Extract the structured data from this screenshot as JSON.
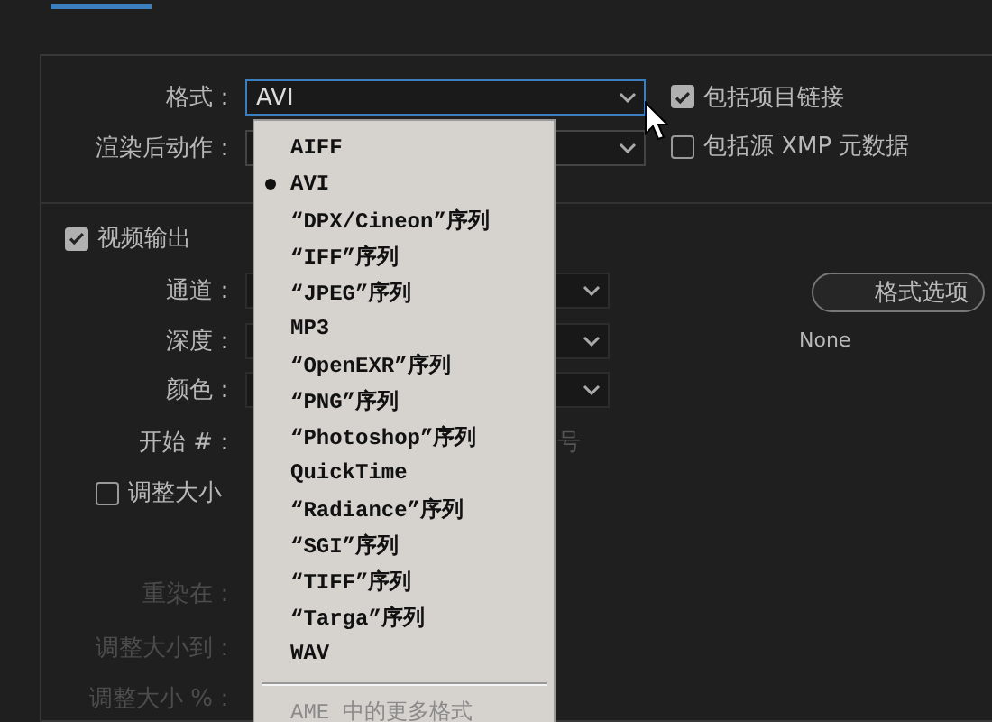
{
  "format": {
    "label": "格式：",
    "value": "AVI"
  },
  "post_render": {
    "label": "渲染后动作："
  },
  "options": [
    {
      "label": "包括项目链接",
      "checked": true
    },
    {
      "label": "包括源 XMP 元数据",
      "checked": false
    }
  ],
  "video_output": {
    "label": "视频输出",
    "checked": true
  },
  "video_fields": [
    {
      "label": "通道："
    },
    {
      "label": "深度："
    },
    {
      "label": "颜色："
    },
    {
      "label": "开始 #：",
      "suffix": "号"
    }
  ],
  "format_options_button": "格式选项",
  "codec_value": "None",
  "resize": {
    "label": "调整大小",
    "checked": false
  },
  "resize_fields": [
    {
      "label": "重染在："
    },
    {
      "label": "调整大小到："
    },
    {
      "label": "调整大小 %："
    }
  ],
  "menu": {
    "items": [
      {
        "label": "AIFF",
        "selected": false
      },
      {
        "label": "AVI",
        "selected": true
      },
      {
        "label": "“DPX/Cineon”序列",
        "selected": false
      },
      {
        "label": "“IFF”序列",
        "selected": false
      },
      {
        "label": "“JPEG”序列",
        "selected": false
      },
      {
        "label": "MP3",
        "selected": false
      },
      {
        "label": "“OpenEXR”序列",
        "selected": false
      },
      {
        "label": "“PNG”序列",
        "selected": false
      },
      {
        "label": "“Photoshop”序列",
        "selected": false
      },
      {
        "label": "QuickTime",
        "selected": false
      },
      {
        "label": "“Radiance”序列",
        "selected": false
      },
      {
        "label": "“SGI”序列",
        "selected": false
      },
      {
        "label": "“TIFF”序列",
        "selected": false
      },
      {
        "label": "“Targa”序列",
        "selected": false
      },
      {
        "label": "WAV",
        "selected": false
      }
    ],
    "more": {
      "label": "AME 中的更多格式",
      "disabled": true
    }
  }
}
